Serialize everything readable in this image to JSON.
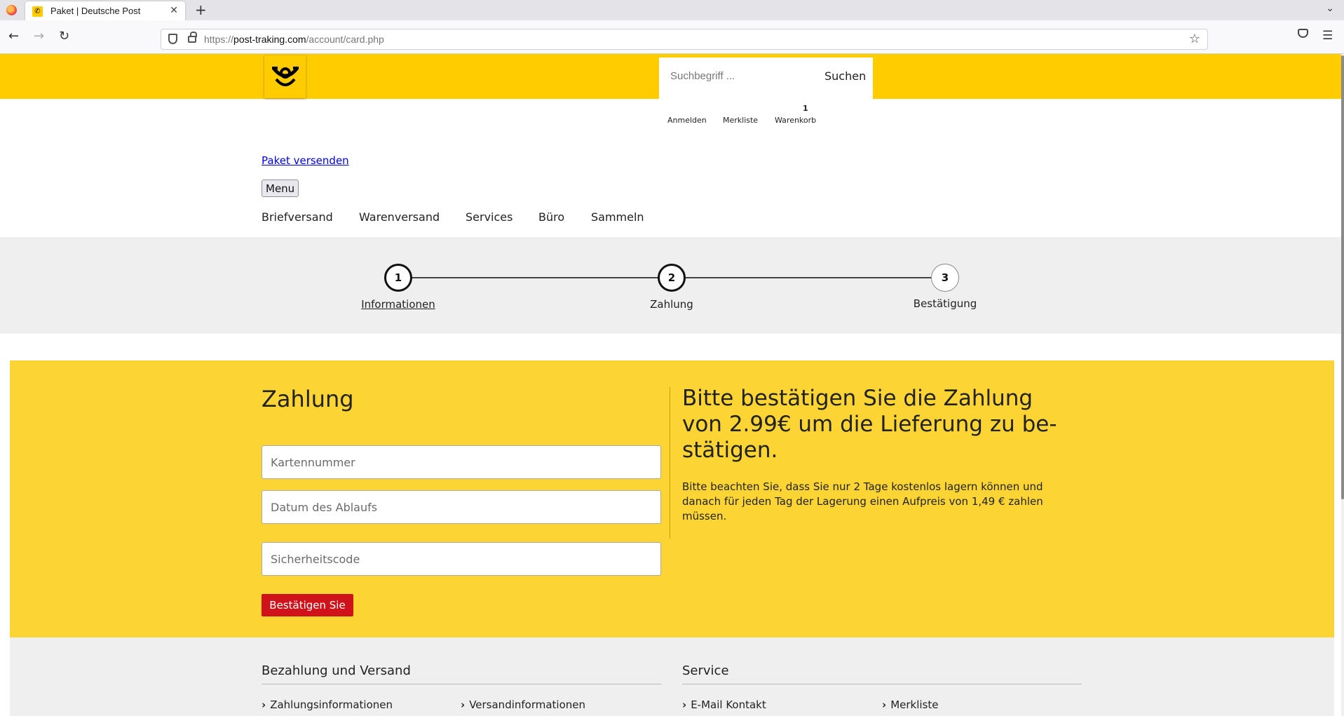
{
  "browser": {
    "tab_title": "Paket | Deutsche Post",
    "url_prefix": "https://",
    "url_host": "post-traking.com",
    "url_path": "/account/card.php"
  },
  "header": {
    "search_placeholder": "Suchbegriff ...",
    "search_button": "Suchen",
    "user_nav": {
      "login": "Anmelden",
      "wishlist": "Merkliste",
      "cart": "Warenkorb",
      "cart_count": "1"
    },
    "brand_color": "#ffcc00"
  },
  "nav": {
    "paket_link": "Paket versenden",
    "menu_button": "Menu",
    "items": [
      "Briefversand",
      "Warenversand",
      "Services",
      "Büro",
      "Sammeln"
    ]
  },
  "steps": [
    {
      "number": "1",
      "label": "Informationen"
    },
    {
      "number": "2",
      "label": "Zahlung"
    },
    {
      "number": "3",
      "label": "Bestätigung"
    }
  ],
  "payment": {
    "title": "Zahlung",
    "card_number_placeholder": "Kartennummer",
    "expiry_placeholder": "Datum des Ablaufs",
    "cvv_placeholder": "Sicherheitscode",
    "confirm_button": "Bestätigen Sie",
    "heading": "Bitte bestätigen Sie die Zahlung von 2.99€ um die Lieferung zu bestätigen.",
    "heading_line1": "Bitte bestätigen Sie die Zahlung",
    "heading_line2": "von 2.99€ um die Lieferung zu be-",
    "heading_line3": "stätigen.",
    "note": "Bitte beachten Sie, dass Sie nur 2 Tage kostenlos lagern können und danach für jeden Tag der Lagerung einen Aufpreis von 1,49 € zahlen müssen.",
    "band_color": "#fcd535",
    "button_color": "#d0131b"
  },
  "footer": {
    "col1_heading": "Bezahlung und Versand",
    "col2_heading": "Service",
    "links": [
      "Zahlungsinformationen",
      "Versandinformationen",
      "E-Mail Kontakt",
      "Merkliste"
    ]
  }
}
